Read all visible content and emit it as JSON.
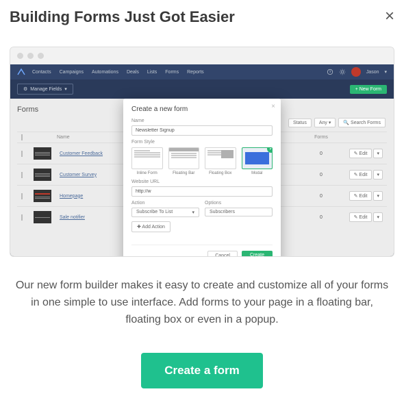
{
  "header": {
    "title": "Building Forms Just Got Easier"
  },
  "app": {
    "nav": [
      "Contacts",
      "Campaigns",
      "Automations",
      "Deals",
      "Lists",
      "Forms",
      "Reports"
    ],
    "user": "Jason",
    "manage_fields": "Manage Fields",
    "new_form_btn": "+ New Form",
    "page_title": "Forms",
    "filters": {
      "status": "Status",
      "any": "Any",
      "search_placeholder": "Search Forms"
    },
    "columns": {
      "name": "Name",
      "forms": "Forms"
    },
    "rows": [
      {
        "name": "Customer Feedback",
        "count": "0",
        "edit": "✎ Edit"
      },
      {
        "name": "Customer Survey",
        "count": "0",
        "edit": "✎ Edit"
      },
      {
        "name": "Homepage",
        "count": "0",
        "edit": "✎ Edit"
      },
      {
        "name": "Sale notifier",
        "count": "0",
        "edit": "✎ Edit"
      }
    ]
  },
  "dialog": {
    "title": "Create a new form",
    "name_label": "Name",
    "name_value": "Newsletter Signup",
    "style_label": "Form Style",
    "styles": [
      "Inline Form",
      "Floating Bar",
      "Floating Box",
      "Modal"
    ],
    "url_label": "Website URL",
    "url_value": "http://w",
    "action_label": "Action",
    "action_value": "Subscribe To List",
    "options_label": "Options",
    "options_value": "Subscribers",
    "add_action": "✚ Add Action",
    "cancel": "Cancel",
    "create": "Create"
  },
  "description": "Our new form builder makes it easy to create and customize all of your forms in one simple to use interface. Add forms to your page in a floating bar, floating box or even in a popup.",
  "cta": "Create a form"
}
